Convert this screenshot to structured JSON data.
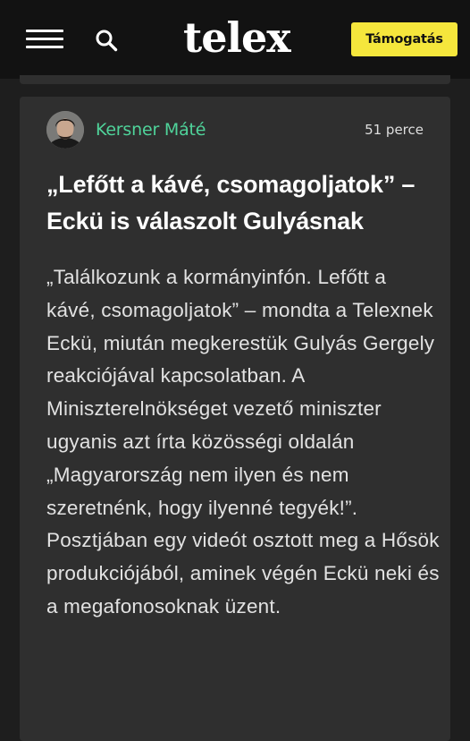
{
  "header": {
    "logo": "telex",
    "support_label": "Támogatás",
    "menu_icon": "hamburger-menu-icon",
    "search_icon": "search-icon"
  },
  "post": {
    "author": "Kersner Máté",
    "time_ago": "51 perce",
    "headline": "„Lefőtt a kávé, csomagoljatok” – Eckü is válaszolt Gulyásnak",
    "body": "„Találkozunk a kormányinfón. Lefőtt a kávé, csomagoljatok” – mondta a Telexnek Eckü, miután megkerestük Gulyás Gergely reakciójával kapcsolatban. A Miniszterelnökséget vezető miniszter ugyanis azt írta közösségi oldalán „Magyarország nem ilyen és nem szeretnénk, hogy ilyenné tegyék!”. Posztjában egy videót osztott meg a Hősök produkciójából, aminek végén Eckü neki és a megafonosoknak üzent."
  },
  "colors": {
    "background": "#1e1e1e",
    "header": "#121212",
    "card": "#2f2f2f",
    "accent_yellow": "#f5e63c",
    "author_green": "#4fd39a"
  }
}
